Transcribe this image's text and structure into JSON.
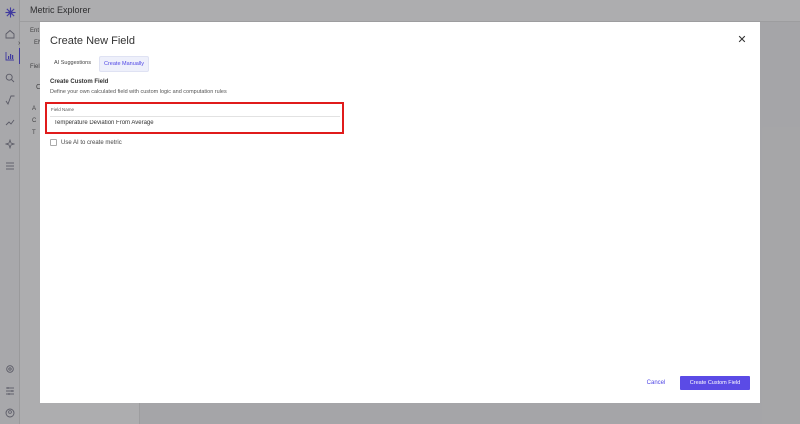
{
  "app": {
    "title": "Metric Explorer"
  },
  "rail": {
    "icons": [
      "logo-icon",
      "home-icon",
      "chart-icon",
      "search-icon",
      "sqrt-icon",
      "trend-icon",
      "sparkle-icon",
      "menu-icon",
      "settings-icon",
      "sliders-icon",
      "user-icon"
    ],
    "accent": "#4f46e5"
  },
  "background_panel": {
    "entity_label": "Ent",
    "entity_value": "EN",
    "fields_label": "Fiel",
    "search_char": "C",
    "tree": [
      "A",
      "C",
      "T"
    ]
  },
  "modal": {
    "title": "Create New Field",
    "close_glyph": "✕",
    "tabs": [
      {
        "label": "AI Suggestions",
        "active": false
      },
      {
        "label": "Create Manually",
        "active": true
      }
    ],
    "section_title": "Create Custom Field",
    "section_description": "Define your own calculated field with custom logic and computation rules",
    "field": {
      "label": "Field Name",
      "value": "Temperature Deviation From Average"
    },
    "checkbox": {
      "label": "Use AI to create metric",
      "checked": false
    },
    "cancel_label": "Cancel",
    "create_label": "Create Custom Field",
    "primary_color": "#5b4be6",
    "highlight_color": "#e01b1b"
  }
}
